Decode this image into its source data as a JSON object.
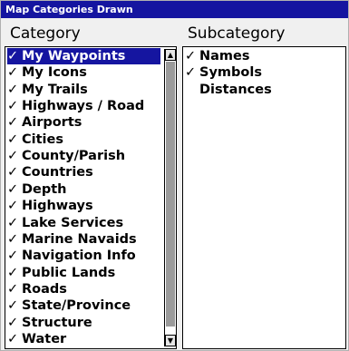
{
  "window": {
    "title": "Map Categories Drawn"
  },
  "headers": {
    "category": "Category",
    "subcategory": "Subcategory"
  },
  "check": "✓",
  "categories": [
    {
      "label": "My Waypoints",
      "checked": true,
      "selected": true
    },
    {
      "label": "My Icons",
      "checked": true
    },
    {
      "label": "My Trails",
      "checked": true
    },
    {
      "label": "Highways / Road",
      "checked": true
    },
    {
      "label": "Airports",
      "checked": true
    },
    {
      "label": "Cities",
      "checked": true
    },
    {
      "label": "County/Parish",
      "checked": true
    },
    {
      "label": "Countries",
      "checked": true
    },
    {
      "label": "Depth",
      "checked": true
    },
    {
      "label": "Highways",
      "checked": true
    },
    {
      "label": "Lake Services",
      "checked": true
    },
    {
      "label": "Marine Navaids",
      "checked": true
    },
    {
      "label": "Navigation Info",
      "checked": true
    },
    {
      "label": "Public Lands",
      "checked": true
    },
    {
      "label": "Roads",
      "checked": true
    },
    {
      "label": "State/Province",
      "checked": true
    },
    {
      "label": "Structure",
      "checked": true
    },
    {
      "label": "Water",
      "checked": true
    }
  ],
  "subcategories": [
    {
      "label": "Names",
      "checked": true
    },
    {
      "label": "Symbols",
      "checked": true
    },
    {
      "label": "Distances",
      "checked": false
    }
  ],
  "scrollbar": {
    "up_glyph": "▲",
    "down_glyph": "▼"
  },
  "colors": {
    "title_bg": "#1515a0",
    "selection_bg": "#1515a0",
    "text": "#000000"
  }
}
